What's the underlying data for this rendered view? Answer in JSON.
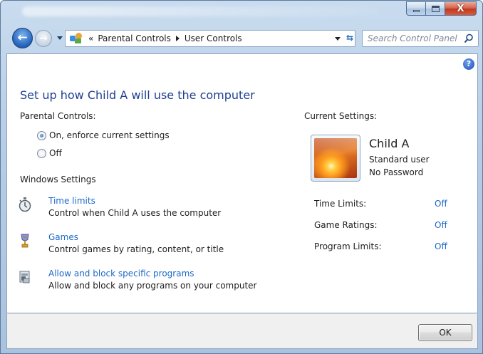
{
  "window": {
    "minimize": "—",
    "maximize": "□",
    "close": "X"
  },
  "nav": {
    "back_icon": "back-arrow-icon",
    "forward_icon": "forward-arrow-icon",
    "breadcrumb_overflow": "«",
    "breadcrumbs": [
      "Parental Controls",
      "User Controls"
    ],
    "refresh_icon": "refresh-icon",
    "search_placeholder": "Search Control Panel"
  },
  "help": {
    "label": "?"
  },
  "main": {
    "title": "Set up how Child A will use the computer",
    "parental_controls_label": "Parental Controls:",
    "options": [
      {
        "label": "On, enforce current settings",
        "checked": true
      },
      {
        "label": "Off",
        "checked": false
      }
    ],
    "windows_settings_label": "Windows Settings",
    "settings": [
      {
        "icon": "stopwatch-icon",
        "link": "Time limits",
        "description": "Control when Child A uses the computer"
      },
      {
        "icon": "trophy-icon",
        "link": "Games",
        "description": "Control games by rating, content, or title"
      },
      {
        "icon": "program-block-icon",
        "link": "Allow and block specific programs",
        "description": "Allow and block any programs on your computer"
      }
    ]
  },
  "current": {
    "label": "Current Settings:",
    "user_name": "Child A",
    "account_type": "Standard user",
    "password_status": "No Password",
    "items": [
      {
        "label": "Time Limits:",
        "value": "Off"
      },
      {
        "label": "Game Ratings:",
        "value": "Off"
      },
      {
        "label": "Program Limits:",
        "value": "Off"
      }
    ]
  },
  "footer": {
    "ok_label": "OK"
  },
  "colors": {
    "link": "#1c69c9",
    "title": "#1e3f91",
    "chrome": "#b7cde6"
  }
}
